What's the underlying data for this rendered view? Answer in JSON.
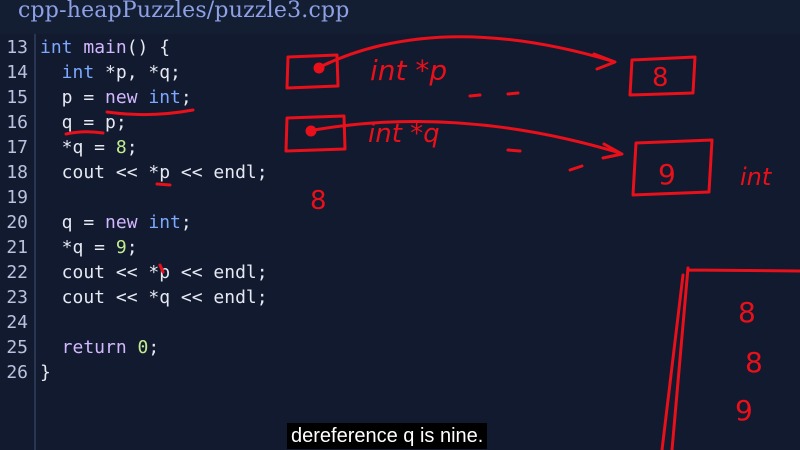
{
  "title": "cpp-heapPuzzles/puzzle3.cpp",
  "lines": [
    {
      "num": "13",
      "tokens": [
        {
          "t": "int",
          "c": "k"
        },
        {
          "t": " main",
          "c": "f"
        },
        {
          "t": "() {",
          "c": "o"
        }
      ]
    },
    {
      "num": "14",
      "tokens": [
        {
          "t": "  int",
          "c": "k"
        },
        {
          "t": " *p, *q;",
          "c": "v"
        }
      ]
    },
    {
      "num": "15",
      "tokens": [
        {
          "t": "  p = ",
          "c": "v"
        },
        {
          "t": "new",
          "c": "f"
        },
        {
          "t": " int",
          "c": "k"
        },
        {
          "t": ";",
          "c": "o"
        }
      ]
    },
    {
      "num": "16",
      "tokens": [
        {
          "t": "  q = p;",
          "c": "v"
        }
      ]
    },
    {
      "num": "17",
      "tokens": [
        {
          "t": "  *q = ",
          "c": "v"
        },
        {
          "t": "8",
          "c": "n"
        },
        {
          "t": ";",
          "c": "o"
        }
      ]
    },
    {
      "num": "18",
      "tokens": [
        {
          "t": "  cout << *p << endl;",
          "c": "v"
        }
      ]
    },
    {
      "num": "19",
      "tokens": []
    },
    {
      "num": "20",
      "tokens": [
        {
          "t": "  q = ",
          "c": "v"
        },
        {
          "t": "new",
          "c": "f"
        },
        {
          "t": " int",
          "c": "k"
        },
        {
          "t": ";",
          "c": "o"
        }
      ]
    },
    {
      "num": "21",
      "tokens": [
        {
          "t": "  *q = ",
          "c": "v"
        },
        {
          "t": "9",
          "c": "n"
        },
        {
          "t": ";",
          "c": "o"
        }
      ]
    },
    {
      "num": "22",
      "tokens": [
        {
          "t": "  cout << *p << endl;",
          "c": "v"
        }
      ]
    },
    {
      "num": "23",
      "tokens": [
        {
          "t": "  cout << *q << endl;",
          "c": "v"
        }
      ]
    },
    {
      "num": "24",
      "tokens": []
    },
    {
      "num": "25",
      "tokens": [
        {
          "t": "  return",
          "c": "f"
        },
        {
          "t": " 0",
          "c": "n"
        },
        {
          "t": ";",
          "c": "o"
        }
      ]
    },
    {
      "num": "26",
      "tokens": [
        {
          "t": "}",
          "c": "o"
        }
      ]
    }
  ],
  "annotations": {
    "label_int_p": "int *p",
    "value_8": "8",
    "label_int_q": "int *q",
    "value_9": "9",
    "label_int": "int",
    "output_first": "8",
    "console_lines": [
      "8",
      "8",
      "9"
    ]
  },
  "caption": "dereference q is nine.",
  "colors": {
    "ink": "#e8101a",
    "background": "#111a2e"
  }
}
